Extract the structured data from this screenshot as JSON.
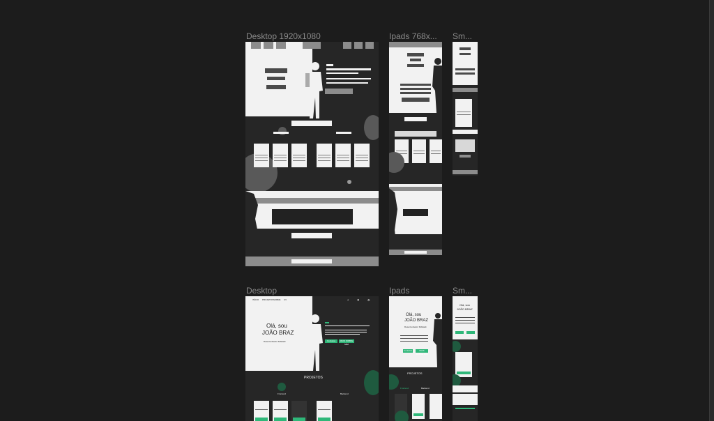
{
  "frames": {
    "desktop_wire": "Desktop 1920x1080",
    "ipad_wire": "Ipads  768x...",
    "small_wire": "Sm...",
    "desktop": "Desktop",
    "ipad": "Ipads",
    "small": "Sm..."
  },
  "hero": {
    "greeting": "Olá, sou",
    "name": "JOÃO BRAZ",
    "subtitle": "Desenvolvedor fullstack"
  },
  "nav": [
    "INÍCIO",
    "PROJETOS",
    "SOBRE",
    "CV"
  ],
  "sections": {
    "projects": "PROJETOS",
    "tab_frontend": "Frontend",
    "tab_backend": "Backend"
  },
  "buttons": {
    "primary": "Contatos",
    "secondary": "MAIS SOBRE MIM"
  },
  "colors": {
    "background": "#1c1c1c",
    "wire_light": "#f2f2f2",
    "wire_gray": "#8c8c8c",
    "accent": "#2fb779"
  }
}
